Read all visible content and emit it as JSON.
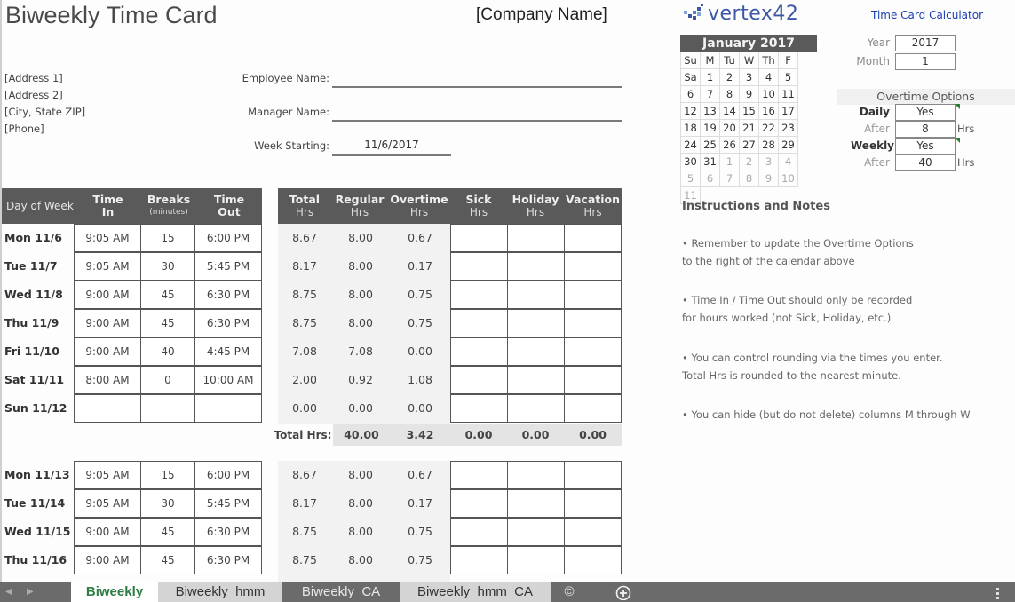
{
  "header": {
    "title": "Biweekly Time Card",
    "company": "[Company Name]",
    "link": "Time Card Calculator",
    "logo": "vertex42"
  },
  "address": [
    "[Address 1]",
    "[Address 2]",
    "[City, State  ZIP]",
    "[Phone]"
  ],
  "fields": {
    "employee_label": "Employee Name:",
    "employee_value": "",
    "manager_label": "Manager Name:",
    "manager_value": "",
    "week_label": "Week Starting:",
    "week_value": "11/6/2017"
  },
  "table": {
    "headers": {
      "day": "Day of Week",
      "time_in": [
        "Time",
        "In"
      ],
      "breaks": [
        "Breaks",
        "(minutes)"
      ],
      "time_out": [
        "Time",
        "Out"
      ],
      "total": [
        "Total",
        "Hrs"
      ],
      "regular": [
        "Regular",
        "Hrs"
      ],
      "overtime": [
        "Overtime",
        "Hrs"
      ],
      "sick": [
        "Sick",
        "Hrs"
      ],
      "holiday": [
        "Holiday",
        "Hrs"
      ],
      "vacation": [
        "Vacation",
        "Hrs"
      ]
    },
    "week1": [
      {
        "day": "Mon 11/6",
        "in": "9:05 AM",
        "breaks": "15",
        "out": "6:00 PM",
        "total": "8.67",
        "regular": "8.00",
        "overtime": "0.67"
      },
      {
        "day": "Tue 11/7",
        "in": "9:05 AM",
        "breaks": "30",
        "out": "5:45 PM",
        "total": "8.17",
        "regular": "8.00",
        "overtime": "0.17"
      },
      {
        "day": "Wed 11/8",
        "in": "9:00 AM",
        "breaks": "45",
        "out": "6:30 PM",
        "total": "8.75",
        "regular": "8.00",
        "overtime": "0.75"
      },
      {
        "day": "Thu 11/9",
        "in": "9:00 AM",
        "breaks": "45",
        "out": "6:30 PM",
        "total": "8.75",
        "regular": "8.00",
        "overtime": "0.75"
      },
      {
        "day": "Fri 11/10",
        "in": "9:00 AM",
        "breaks": "40",
        "out": "4:45 PM",
        "total": "7.08",
        "regular": "7.08",
        "overtime": "0.00"
      },
      {
        "day": "Sat 11/11",
        "in": "8:00 AM",
        "breaks": "0",
        "out": "10:00 AM",
        "total": "2.00",
        "regular": "0.92",
        "overtime": "1.08"
      },
      {
        "day": "Sun 11/12",
        "in": "",
        "breaks": "",
        "out": "",
        "total": "0.00",
        "regular": "0.00",
        "overtime": "0.00"
      }
    ],
    "week1_totals": {
      "label": "Total Hrs:",
      "regular": "40.00",
      "overtime": "3.42",
      "sick": "0.00",
      "holiday": "0.00",
      "vacation": "0.00"
    },
    "week2": [
      {
        "day": "Mon 11/13",
        "in": "9:05 AM",
        "breaks": "15",
        "out": "6:00 PM",
        "total": "8.67",
        "regular": "8.00",
        "overtime": "0.67"
      },
      {
        "day": "Tue 11/14",
        "in": "9:05 AM",
        "breaks": "30",
        "out": "5:45 PM",
        "total": "8.17",
        "regular": "8.00",
        "overtime": "0.17"
      },
      {
        "day": "Wed 11/15",
        "in": "9:00 AM",
        "breaks": "45",
        "out": "6:30 PM",
        "total": "8.75",
        "regular": "8.00",
        "overtime": "0.75"
      },
      {
        "day": "Thu 11/16",
        "in": "9:00 AM",
        "breaks": "45",
        "out": "6:30 PM",
        "total": "8.75",
        "regular": "8.00",
        "overtime": "0.75"
      }
    ]
  },
  "calendar": {
    "title": "January 2017",
    "weekdays": [
      "Su",
      "M",
      "Tu",
      "W",
      "Th",
      "F",
      "Sa"
    ],
    "days": [
      [
        "1",
        "2",
        "3",
        "4",
        "5",
        "6",
        "7"
      ],
      [
        "8",
        "9",
        "10",
        "11",
        "12",
        "13",
        "14"
      ],
      [
        "15",
        "16",
        "17",
        "18",
        "19",
        "20",
        "21"
      ],
      [
        "22",
        "23",
        "24",
        "25",
        "26",
        "27",
        "28"
      ],
      [
        "29",
        "30",
        "31",
        "1",
        "2",
        "3",
        "4"
      ],
      [
        "5",
        "6",
        "7",
        "8",
        "9",
        "10",
        "11"
      ]
    ],
    "dim_from_index": 31
  },
  "settings": {
    "year_label": "Year",
    "year": "2017",
    "month_label": "Month",
    "month": "1",
    "overtime_title": "Overtime Options",
    "daily_label": "Daily",
    "daily": "Yes",
    "daily_after_label": "After",
    "daily_after": "8",
    "daily_unit": "Hrs",
    "weekly_label": "Weekly",
    "weekly": "Yes",
    "weekly_after_label": "After",
    "weekly_after": "40",
    "weekly_unit": "Hrs"
  },
  "notes": {
    "title": "Instructions and Notes",
    "items": [
      [
        "• Remember to update the Overtime Options",
        "to the right of the calendar above"
      ],
      [
        "• Time In / Time Out should only be recorded",
        "for hours worked (not Sick, Holiday, etc.)"
      ],
      [
        "• You can control rounding via the times you enter.",
        "Total Hrs is rounded to the nearest minute."
      ],
      [
        "• You can hide (but do not delete) columns M through W"
      ]
    ]
  },
  "tabs": [
    {
      "label": "Biweekly",
      "state": "active"
    },
    {
      "label": "Biweekly_hmm",
      "state": "normal"
    },
    {
      "label": "Biweekly_CA",
      "state": "dark"
    },
    {
      "label": "Biweekly_hmm_CA",
      "state": "normal"
    },
    {
      "label": "©",
      "state": "dark"
    }
  ]
}
